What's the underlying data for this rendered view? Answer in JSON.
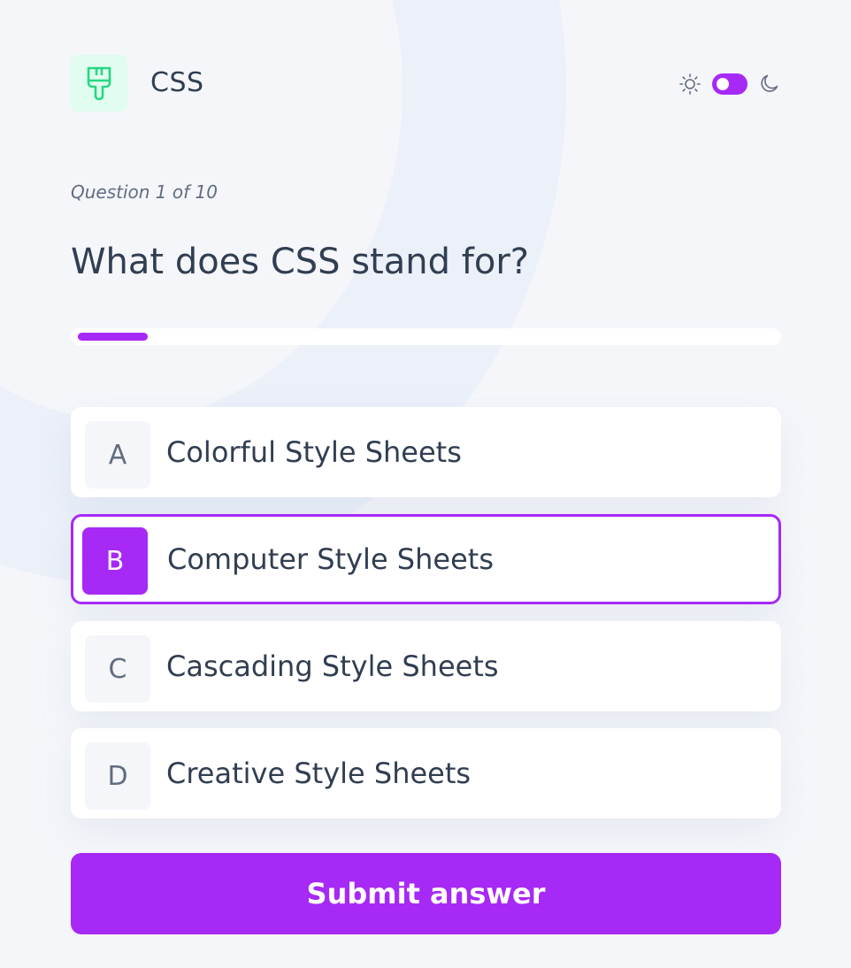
{
  "header": {
    "subject_title": "CSS",
    "subject_icon": "paintbrush-icon",
    "theme": {
      "light_icon": "sun-icon",
      "dark_icon": "moon-icon",
      "mode": "light"
    }
  },
  "quiz": {
    "question_counter": "Question 1 of 10",
    "question": "What does CSS stand for?",
    "progress": 0.1,
    "options": [
      {
        "letter": "A",
        "text": "Colorful Style Sheets",
        "selected": false
      },
      {
        "letter": "B",
        "text": "Computer Style Sheets",
        "selected": true
      },
      {
        "letter": "C",
        "text": "Cascading Style Sheets",
        "selected": false
      },
      {
        "letter": "D",
        "text": "Creative Style Sheets",
        "selected": false
      }
    ],
    "submit_label": "Submit answer"
  },
  "colors": {
    "accent": "#A729F5",
    "background": "#F4F6FA",
    "text_dark": "#313E51",
    "text_muted": "#626C7F",
    "icon_bg": "#E0FDEF",
    "icon_stroke": "#26D782"
  }
}
